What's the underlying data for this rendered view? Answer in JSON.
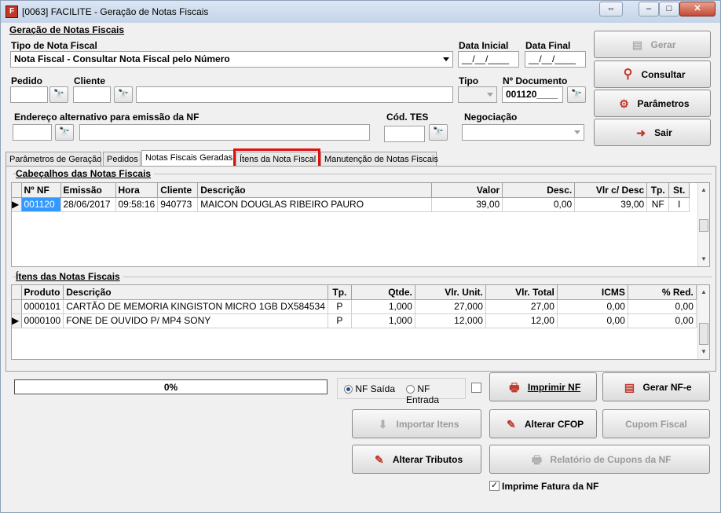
{
  "window": {
    "title": "[0063] FACILITE - Geração de Notas Fiscais",
    "app_icon_letter": "F"
  },
  "header": {
    "group_title": "Geração de Notas Fiscais",
    "tipo_label": "Tipo de Nota Fiscal",
    "tipo_value": "Nota Fiscal - Consultar Nota Fiscal pelo Número",
    "data_inicial_label": "Data Inicial",
    "data_inicial_value": "__/__/____",
    "data_final_label": "Data Final",
    "data_final_value": "__/__/____",
    "pedido_label": "Pedido",
    "cliente_label": "Cliente",
    "tipo2_label": "Tipo",
    "documento_label": "Nº Documento",
    "documento_value": "001120____",
    "endereco_label": "Endereço alternativo para emissão da NF",
    "cod_tes_label": "Cód. TES",
    "negociacao_label": "Negociação"
  },
  "side_buttons": {
    "gerar": "Gerar",
    "consultar": "Consultar",
    "parametros": "Parâmetros",
    "sair": "Sair"
  },
  "tabs": [
    "Parâmetros de Geração",
    "Pedidos",
    "Notas Fiscais Geradas",
    "Ítens da Nota Fiscal",
    "Manutenção de Notas Fiscais"
  ],
  "notas": {
    "title": "Cabeçalhos das Notas Fiscais",
    "columns": [
      "Nº NF",
      "Emissão",
      "Hora",
      "Cliente",
      "Descrição",
      "Valor",
      "Desc.",
      "Vlr c/ Desc",
      "Tp.",
      "St."
    ],
    "rows": [
      [
        "001120",
        "28/06/2017",
        "09:58:16",
        "940773",
        "MAICON DOUGLAS RIBEIRO PAURO",
        "39,00",
        "0,00",
        "39,00",
        "NF",
        "I"
      ]
    ]
  },
  "itens": {
    "title": "Ítens das Notas Fiscais",
    "columns": [
      "Produto",
      "Descrição",
      "Tp.",
      "Qtde.",
      "Vlr. Unit.",
      "Vlr. Total",
      "ICMS",
      "% Red."
    ],
    "rows": [
      [
        "0000101",
        "CARTÃO DE MEMORIA KINGISTON MICRO 1GB DX584534",
        "P",
        "1,000",
        "27,000",
        "27,00",
        "0,00",
        "0,00"
      ],
      [
        "0000100",
        "FONE DE OUVIDO P/ MP4 SONY",
        "P",
        "1,000",
        "12,000",
        "12,00",
        "0,00",
        "0,00"
      ]
    ]
  },
  "bottom": {
    "progress": "0%",
    "progress_value": 0,
    "nf_saida": "NF Saída",
    "nf_entrada": "NF Entrada",
    "imprimir_nf": "Imprimir NF",
    "gerar_nfe": "Gerar NF-e",
    "importar_itens": "Importar Itens",
    "alterar_cfop": "Alterar CFOP",
    "cupom_fiscal": "Cupom Fiscal",
    "alterar_tributos": "Alterar Tributos",
    "relatorio_cupons": "Relatório de Cupons da NF",
    "imprime_fatura": "Imprime Fatura da NF"
  }
}
